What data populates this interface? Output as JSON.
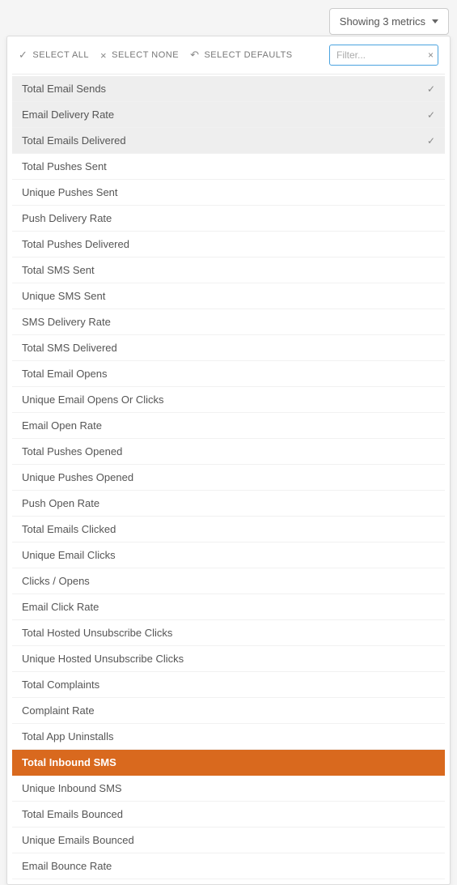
{
  "header": {
    "toggle_label": "Showing 3 metrics"
  },
  "toolbar": {
    "select_all_label": "SELECT ALL",
    "select_none_label": "SELECT NONE",
    "select_defaults_label": "SELECT DEFAULTS",
    "filter_placeholder": "Filter...",
    "filter_value": ""
  },
  "metrics": [
    {
      "label": "Total Email Sends",
      "selected": true,
      "highlighted": false
    },
    {
      "label": "Email Delivery Rate",
      "selected": true,
      "highlighted": false
    },
    {
      "label": "Total Emails Delivered",
      "selected": true,
      "highlighted": false
    },
    {
      "label": "Total Pushes Sent",
      "selected": false,
      "highlighted": false
    },
    {
      "label": "Unique Pushes Sent",
      "selected": false,
      "highlighted": false
    },
    {
      "label": "Push Delivery Rate",
      "selected": false,
      "highlighted": false
    },
    {
      "label": "Total Pushes Delivered",
      "selected": false,
      "highlighted": false
    },
    {
      "label": "Total SMS Sent",
      "selected": false,
      "highlighted": false
    },
    {
      "label": "Unique SMS Sent",
      "selected": false,
      "highlighted": false
    },
    {
      "label": "SMS Delivery Rate",
      "selected": false,
      "highlighted": false
    },
    {
      "label": "Total SMS Delivered",
      "selected": false,
      "highlighted": false
    },
    {
      "label": "Total Email Opens",
      "selected": false,
      "highlighted": false
    },
    {
      "label": "Unique Email Opens Or Clicks",
      "selected": false,
      "highlighted": false
    },
    {
      "label": "Email Open Rate",
      "selected": false,
      "highlighted": false
    },
    {
      "label": "Total Pushes Opened",
      "selected": false,
      "highlighted": false
    },
    {
      "label": "Unique Pushes Opened",
      "selected": false,
      "highlighted": false
    },
    {
      "label": "Push Open Rate",
      "selected": false,
      "highlighted": false
    },
    {
      "label": "Total Emails Clicked",
      "selected": false,
      "highlighted": false
    },
    {
      "label": "Unique Email Clicks",
      "selected": false,
      "highlighted": false
    },
    {
      "label": "Clicks / Opens",
      "selected": false,
      "highlighted": false
    },
    {
      "label": "Email Click Rate",
      "selected": false,
      "highlighted": false
    },
    {
      "label": "Total Hosted Unsubscribe Clicks",
      "selected": false,
      "highlighted": false
    },
    {
      "label": "Unique Hosted Unsubscribe Clicks",
      "selected": false,
      "highlighted": false
    },
    {
      "label": "Total Complaints",
      "selected": false,
      "highlighted": false
    },
    {
      "label": "Complaint Rate",
      "selected": false,
      "highlighted": false
    },
    {
      "label": "Total App Uninstalls",
      "selected": false,
      "highlighted": false
    },
    {
      "label": "Total Inbound SMS",
      "selected": false,
      "highlighted": true
    },
    {
      "label": "Unique Inbound SMS",
      "selected": false,
      "highlighted": false
    },
    {
      "label": "Total Emails Bounced",
      "selected": false,
      "highlighted": false
    },
    {
      "label": "Unique Emails Bounced",
      "selected": false,
      "highlighted": false
    },
    {
      "label": "Email Bounce Rate",
      "selected": false,
      "highlighted": false
    }
  ]
}
